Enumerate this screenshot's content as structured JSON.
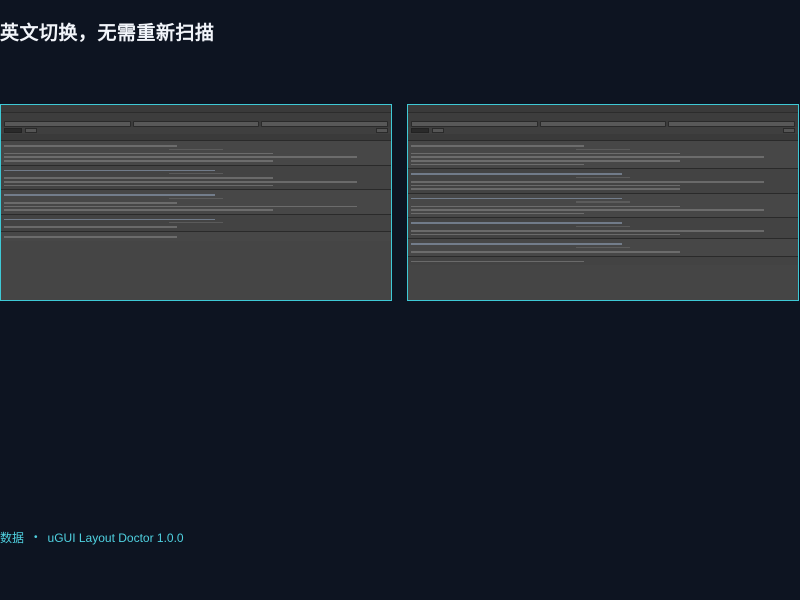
{
  "headline": "英文切换，无需重新扫描",
  "screenshots": {
    "left": {
      "toolbar_buttons": [
        "",
        "",
        ""
      ],
      "issue_titles": [
        "",
        "",
        "",
        "",
        ""
      ]
    },
    "right": {
      "toolbar_buttons": [
        "",
        "",
        ""
      ],
      "issue_titles": [
        "",
        "",
        "",
        "",
        "",
        ""
      ]
    }
  },
  "footer": {
    "left_text": "数据",
    "product": "uGUI Layout Doctor 1.0.0"
  },
  "colors": {
    "background": "#0d1421",
    "accent": "#3ec9d6",
    "panel": "#454545"
  }
}
